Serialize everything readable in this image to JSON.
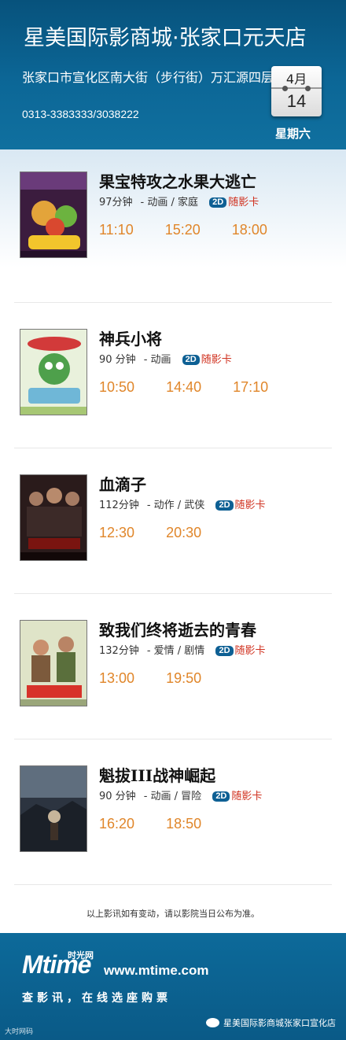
{
  "header": {
    "title": "星美国际影商城·张家口元天店",
    "address": "张家口市宣化区南大街（步行街）万汇源四层",
    "phone": "0313-3383333/3038222",
    "month": "4月",
    "day": "14",
    "weekday": "星期六"
  },
  "movies": [
    {
      "title": "果宝特攻之水果大逃亡",
      "duration": "97分钟",
      "genre": "动画 / 家庭",
      "format": "2D",
      "card": "随影卡",
      "times": [
        "11:10",
        "15:20",
        "18:00"
      ]
    },
    {
      "title": "神兵小将",
      "duration": "90 分钟",
      "genre": "动画",
      "format": "2D",
      "card": "随影卡",
      "times": [
        "10:50",
        "14:40",
        "17:10"
      ]
    },
    {
      "title": "血滴子",
      "duration": "112分钟",
      "genre": "动作 / 武侠",
      "format": "2D",
      "card": "随影卡",
      "times": [
        "12:30",
        "20:30"
      ]
    },
    {
      "title": "致我们终将逝去的青春",
      "duration": "132分钟",
      "genre": "爱情 / 剧情",
      "format": "2D",
      "card": "随影卡",
      "times": [
        "13:00",
        "19:50"
      ]
    },
    {
      "title": "魁拔III战神崛起",
      "duration": "90 分钟",
      "genre": "动画 / 冒险",
      "format": "2D",
      "card": "随影卡",
      "times": [
        "16:20",
        "18:50"
      ]
    }
  ],
  "notice": "以上影讯如有变动，请以影院当日公布为准。",
  "footer": {
    "logo_m": "Mtime",
    "logo_cn": "时光网",
    "url": "www.mtime.com",
    "slogan": "查影讯，在线选座购票",
    "brand": "星美国际影商城张家口宣化店",
    "tiny": "大时网码"
  },
  "colors": {
    "header": "#0c6797",
    "time": "#e0862a",
    "card": "#d0311f",
    "badge": "#0e6094"
  }
}
